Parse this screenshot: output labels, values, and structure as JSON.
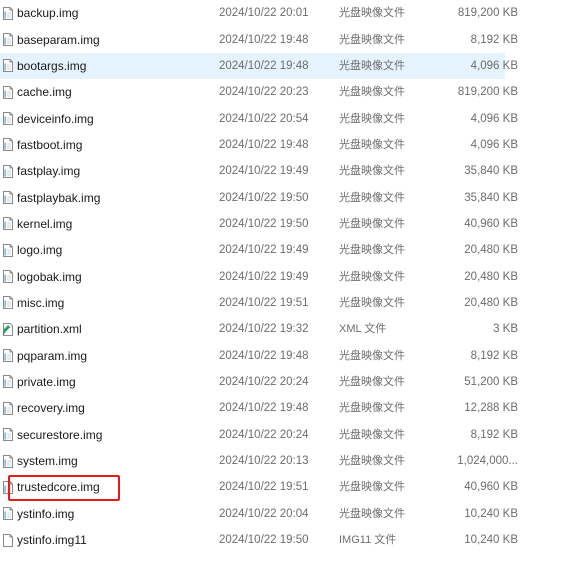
{
  "files": [
    {
      "name": "backup.img",
      "date": "2024/10/22 20:01",
      "type": "光盘映像文件",
      "size": "819,200 KB",
      "icon": "disk-image-file-icon"
    },
    {
      "name": "baseparam.img",
      "date": "2024/10/22 19:48",
      "type": "光盘映像文件",
      "size": "8,192 KB",
      "icon": "disk-image-file-icon"
    },
    {
      "name": "bootargs.img",
      "date": "2024/10/22 19:48",
      "type": "光盘映像文件",
      "size": "4,096 KB",
      "icon": "disk-image-file-icon",
      "selected": true
    },
    {
      "name": "cache.img",
      "date": "2024/10/22 20:23",
      "type": "光盘映像文件",
      "size": "819,200 KB",
      "icon": "disk-image-file-icon"
    },
    {
      "name": "deviceinfo.img",
      "date": "2024/10/22 20:54",
      "type": "光盘映像文件",
      "size": "4,096 KB",
      "icon": "disk-image-file-icon"
    },
    {
      "name": "fastboot.img",
      "date": "2024/10/22 19:48",
      "type": "光盘映像文件",
      "size": "4,096 KB",
      "icon": "disk-image-file-icon"
    },
    {
      "name": "fastplay.img",
      "date": "2024/10/22 19:49",
      "type": "光盘映像文件",
      "size": "35,840 KB",
      "icon": "disk-image-file-icon"
    },
    {
      "name": "fastplaybak.img",
      "date": "2024/10/22 19:50",
      "type": "光盘映像文件",
      "size": "35,840 KB",
      "icon": "disk-image-file-icon"
    },
    {
      "name": "kernel.img",
      "date": "2024/10/22 19:50",
      "type": "光盘映像文件",
      "size": "40,960 KB",
      "icon": "disk-image-file-icon"
    },
    {
      "name": "logo.img",
      "date": "2024/10/22 19:49",
      "type": "光盘映像文件",
      "size": "20,480 KB",
      "icon": "disk-image-file-icon"
    },
    {
      "name": "logobak.img",
      "date": "2024/10/22 19:49",
      "type": "光盘映像文件",
      "size": "20,480 KB",
      "icon": "disk-image-file-icon"
    },
    {
      "name": "misc.img",
      "date": "2024/10/22 19:51",
      "type": "光盘映像文件",
      "size": "20,480 KB",
      "icon": "disk-image-file-icon"
    },
    {
      "name": "partition.xml",
      "date": "2024/10/22 19:32",
      "type": "XML 文件",
      "size": "3 KB",
      "icon": "xml-file-icon"
    },
    {
      "name": "pqparam.img",
      "date": "2024/10/22 19:48",
      "type": "光盘映像文件",
      "size": "8,192 KB",
      "icon": "disk-image-file-icon"
    },
    {
      "name": "private.img",
      "date": "2024/10/22 20:24",
      "type": "光盘映像文件",
      "size": "51,200 KB",
      "icon": "disk-image-file-icon"
    },
    {
      "name": "recovery.img",
      "date": "2024/10/22 19:48",
      "type": "光盘映像文件",
      "size": "12,288 KB",
      "icon": "disk-image-file-icon"
    },
    {
      "name": "securestore.img",
      "date": "2024/10/22 20:24",
      "type": "光盘映像文件",
      "size": "8,192 KB",
      "icon": "disk-image-file-icon"
    },
    {
      "name": "system.img",
      "date": "2024/10/22 20:13",
      "type": "光盘映像文件",
      "size": "1,024,000...",
      "icon": "disk-image-file-icon"
    },
    {
      "name": "trustedcore.img",
      "date": "2024/10/22 19:51",
      "type": "光盘映像文件",
      "size": "40,960 KB",
      "icon": "disk-image-file-icon",
      "highlighted": true
    },
    {
      "name": "ystinfo.img",
      "date": "2024/10/22 20:04",
      "type": "光盘映像文件",
      "size": "10,240 KB",
      "icon": "disk-image-file-icon"
    },
    {
      "name": "ystinfo.img11",
      "date": "2024/10/22 19:50",
      "type": "IMG11 文件",
      "size": "10,240 KB",
      "icon": "blank-file-icon"
    }
  ],
  "colors": {
    "selection": "#e5f3ff",
    "callout_border": "#e21b1b",
    "file_icon_fill": "#ffffff",
    "file_icon_stroke": "#8a8a8a",
    "disk_strip": "#4aa0e6",
    "xml_icon": "#2fae6b"
  }
}
